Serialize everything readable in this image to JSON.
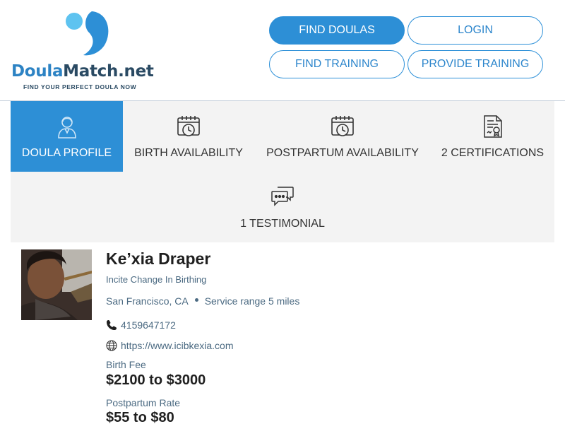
{
  "brand": {
    "name_part1": "Doula",
    "name_part2": "Match.net",
    "tagline": "FIND YOUR PERFECT DOULA NOW",
    "primary_color": "#2d8fd6"
  },
  "nav": {
    "find_doulas": "FIND DOULAS",
    "login": "LOGIN",
    "find_training": "FIND TRAINING",
    "provide_training": "PROVIDE TRAINING"
  },
  "tabs": [
    {
      "label": "DOULA PROFILE",
      "icon": "doula-profile-icon",
      "active": true
    },
    {
      "label": "BIRTH AVAILABILITY",
      "icon": "calendar-clock-icon",
      "active": false
    },
    {
      "label": "POSTPARTUM AVAILABILITY",
      "icon": "calendar-clock-icon",
      "active": false
    },
    {
      "label": "2 CERTIFICATIONS",
      "icon": "certificate-icon",
      "active": false
    },
    {
      "label": "1 TESTIMONIAL",
      "icon": "chat-bubbles-icon",
      "active": false
    }
  ],
  "profile": {
    "name": "Ke’xia Draper",
    "business": "Incite Change In Birthing",
    "city": "San Francisco, CA",
    "service_range": "Service range 5 miles",
    "phone": "4159647172",
    "website": "https://www.icibkexia.com",
    "birth_fee_label": "Birth Fee",
    "birth_fee_value": "$2100 to $3000",
    "postpartum_label": "Postpartum Rate",
    "postpartum_value": "$55 to $80"
  }
}
